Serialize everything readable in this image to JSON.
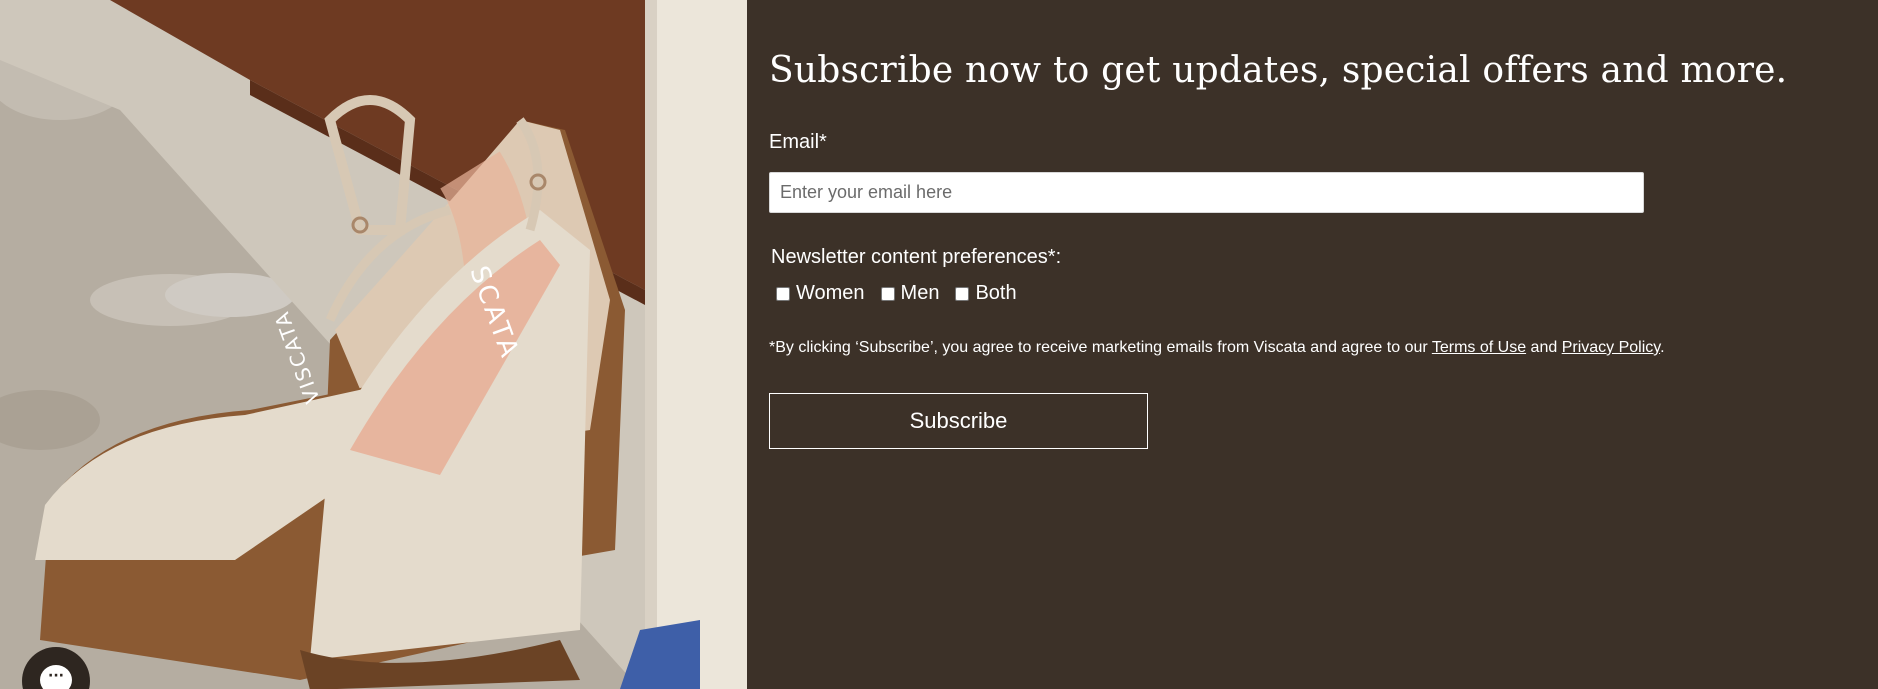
{
  "hero": {
    "brand_lettering": "VISCATA BARCELONA"
  },
  "chat": {
    "glyph": "···",
    "icon": "chat-bubble-icon"
  },
  "form": {
    "title": "Subscribe now to get updates, special offers and more.",
    "email_label": "Email*",
    "email_placeholder": "Enter your email here",
    "email_value": "",
    "preferences_label": "Newsletter content preferences*:",
    "options": [
      {
        "label": "Women",
        "checked": false
      },
      {
        "label": "Men",
        "checked": false
      },
      {
        "label": "Both",
        "checked": false
      }
    ],
    "legal_prefix": "*By clicking ‘Subscribe’, you agree to receive marketing emails from Viscata and agree to our ",
    "terms_link": "Terms of Use",
    "legal_and": " and ",
    "privacy_link": "Privacy Policy",
    "legal_suffix": ".",
    "subscribe_label": "Subscribe"
  },
  "colors": {
    "panel_bg": "#3c3128",
    "text": "#ffffff",
    "chat_bg": "#2e2620"
  }
}
